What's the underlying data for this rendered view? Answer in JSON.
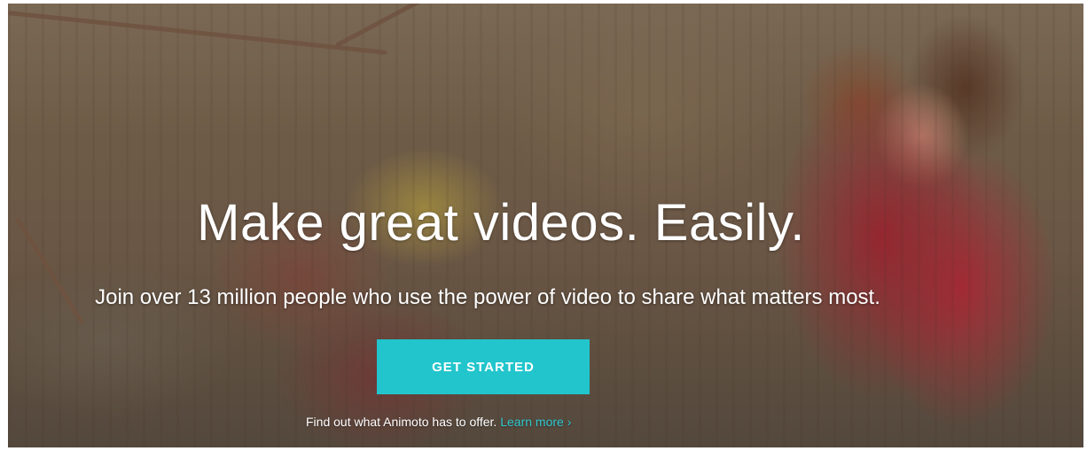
{
  "hero": {
    "headline": "Make great videos. Easily.",
    "subheadline": "Join over 13 million people who use the power of video to share what matters most.",
    "cta_label": "GET STARTED",
    "offer_text": "Find out what Animoto has to offer.",
    "learn_more_label": "Learn more ›",
    "accent_color": "#22c5cc"
  }
}
